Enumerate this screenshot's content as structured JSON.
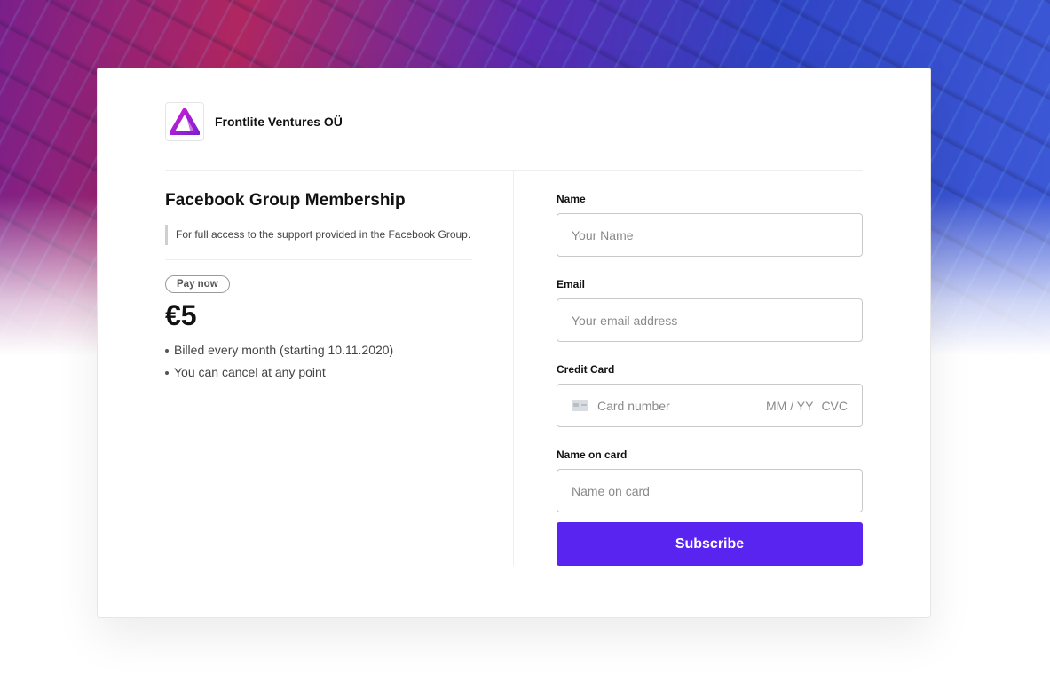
{
  "merchant": {
    "name": "Frontlite Ventures OÜ",
    "logo_icon": "triangle-logo-icon"
  },
  "product": {
    "title": "Facebook Group Membership",
    "description": "For full access to the support provided in the Facebook Group.",
    "badge": "Pay now",
    "price": "€5",
    "bullets": [
      "Billed every month (starting 10.11.2020)",
      "You can cancel at any point"
    ]
  },
  "form": {
    "name": {
      "label": "Name",
      "placeholder": "Your Name"
    },
    "email": {
      "label": "Email",
      "placeholder": "Your email address"
    },
    "credit_card": {
      "label": "Credit Card",
      "icon": "credit-card-icon",
      "number_placeholder": "Card number",
      "expiry_placeholder": "MM / YY",
      "cvc_placeholder": "CVC"
    },
    "name_on_card": {
      "label": "Name on card",
      "placeholder": "Name on card"
    },
    "submit_label": "Subscribe"
  },
  "colors": {
    "accent": "#5a24f0",
    "logo_gradient_start": "#c21fd6",
    "logo_gradient_end": "#7a1fd0"
  }
}
